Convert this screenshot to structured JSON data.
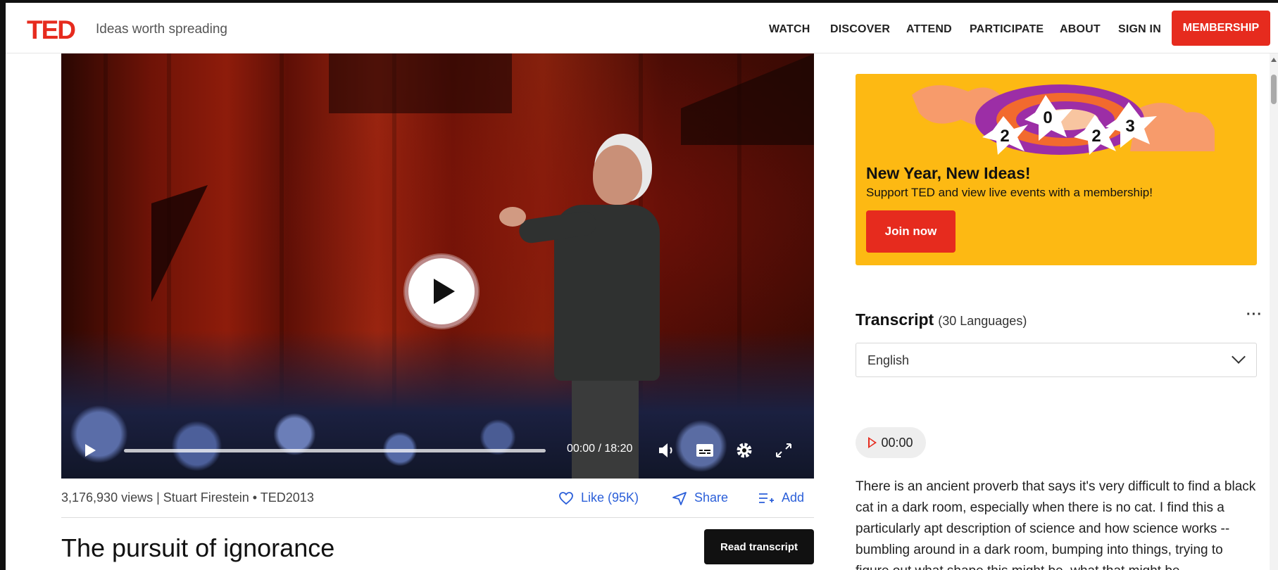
{
  "header": {
    "logo": "TED",
    "tagline": "Ideas worth spreading",
    "nav": [
      "WATCH",
      "DISCOVER",
      "ATTEND",
      "PARTICIPATE",
      "ABOUT",
      "SIGN IN"
    ],
    "membership_label": "MEMBERSHIP"
  },
  "player": {
    "time": "00:00 / 18:20",
    "progress": 0
  },
  "talk": {
    "meta": "3,176,930 views | Stuart Firestein • TED2013",
    "like_label": "Like (95K)",
    "share_label": "Share",
    "add_label": "Add",
    "title": "The pursuit of ignorance",
    "read_transcript_label": "Read transcript"
  },
  "promo": {
    "year_digits": [
      "2",
      "0",
      "2",
      "3"
    ],
    "title": "New Year, New Ideas!",
    "subtitle": "Support TED and view live events with a membership!",
    "join_label": "Join now"
  },
  "transcript": {
    "title": "Transcript",
    "languages": "(30 Languages)",
    "more": "···",
    "selected_language": "English",
    "chip_time": "00:00",
    "text": "There is an ancient proverb that says it's very difficult to find a black cat in a dark room, especially when there is no cat. I find this a particularly apt description of science and how science works -- bumbling around in a dark room, bumping into things, trying to figure out what shape this might be, what that might be"
  },
  "colors": {
    "brand_red": "#e62b1e",
    "promo_yellow": "#fdb913",
    "link_blue": "#2b5fd9"
  }
}
